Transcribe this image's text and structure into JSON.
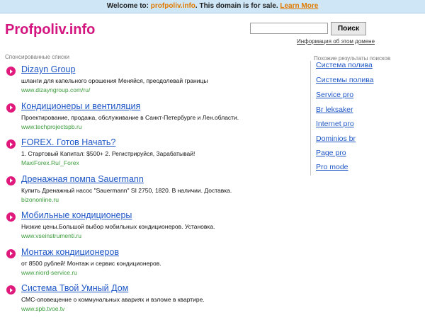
{
  "topbar": {
    "prefix": "Welcome to:",
    "domain": "profpoliv.info",
    "middle": ". This domain is for sale.",
    "learn_more": "Learn More"
  },
  "logo": "Profpoliv.info",
  "search": {
    "value": "",
    "placeholder": "",
    "button_label": "Поиск",
    "domain_info_link": "Информация об этом домене"
  },
  "sponsored_heading": "Спонсированные списки",
  "ads": [
    {
      "title": "Dizayn Group",
      "desc": "шланги для капельного орошения Меняйся, преодолевай границы",
      "url": "www.dizayngroup.com/ru/"
    },
    {
      "title": "Кондиционеры и вентиляция",
      "desc": "Проектирование, продажа, обслуживание в Санкт-Петербурге и Лен.области.",
      "url": "www.techprojectspb.ru"
    },
    {
      "title": "FOREX. Готов Начать?",
      "desc": "1. Стартовый Капитал: $500+ 2. Регистрируйся, Зарабатывай!",
      "url": "MaxiForex.Ru/_Forex"
    },
    {
      "title": "Дренажная помпа Sauermann",
      "desc": "Купить Дренажный насос \"Sauermann\" SI 2750, 1820. В наличии. Доставка.",
      "url": "bizononline.ru"
    },
    {
      "title": "Мобильные кондиционеры",
      "desc": "Низкие цены.Большой выбор мобильных кондиционеров. Установка.",
      "url": "www.vseinstrumenti.ru"
    },
    {
      "title": "Монтаж кондиционеров",
      "desc": "от 8500 рублей! Монтаж и сервис кондиционеров.",
      "url": "www.niord-service.ru"
    },
    {
      "title": "Система Твой Умный Дом",
      "desc": "СМС-оповещение о коммунальных авариях и взломе в квартире.",
      "url": "www.spb.tvoe.tv"
    }
  ],
  "related_heading": "Похожие результаты поисков",
  "related": [
    "Система полива",
    "Системы полива",
    "Service pro",
    "Br leksaker",
    "Internet pro",
    "Dominios br",
    "Page pro",
    "Pro mode"
  ],
  "colors": {
    "topbar_bg": "#cfe6f6",
    "accent": "#e07b00",
    "logo": "#d4157f",
    "link": "#1f57c7",
    "url_green": "#3a9b3a"
  }
}
